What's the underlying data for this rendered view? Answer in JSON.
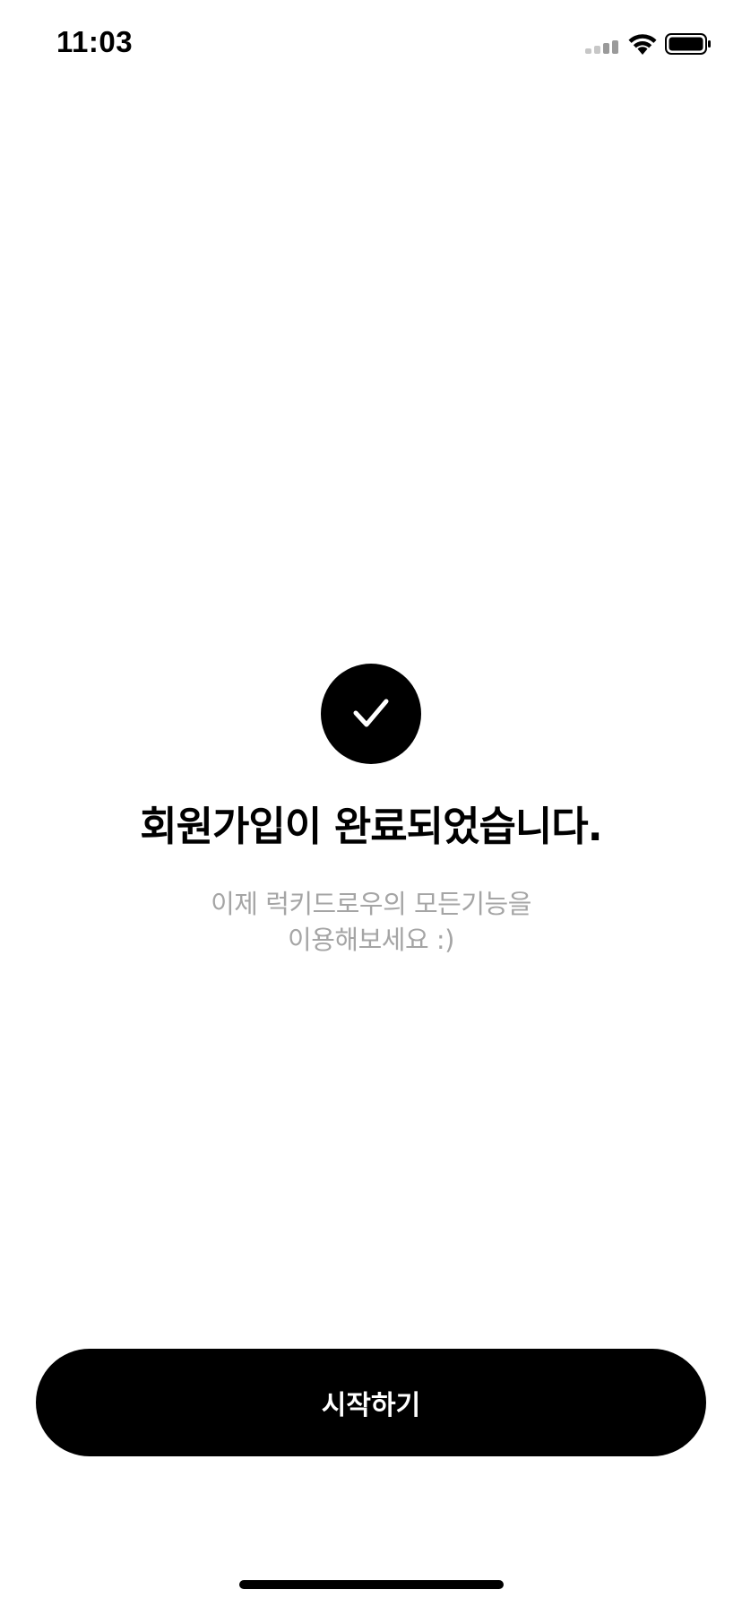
{
  "status_bar": {
    "time": "11:03",
    "signal_icon": "cellular-signal-icon",
    "wifi_icon": "wifi-icon",
    "battery_icon": "battery-icon"
  },
  "success": {
    "icon": "checkmark-icon",
    "title": "회원가입이 완료되었습니다.",
    "subtitle_line1": "이제 럭키드로우의 모든기능을",
    "subtitle_line2": "이용해보세요 :)"
  },
  "actions": {
    "start_label": "시작하기"
  },
  "colors": {
    "primary": "#000000",
    "background": "#ffffff",
    "subtitle_text": "#a5a5a5",
    "button_text": "#ffffff"
  }
}
